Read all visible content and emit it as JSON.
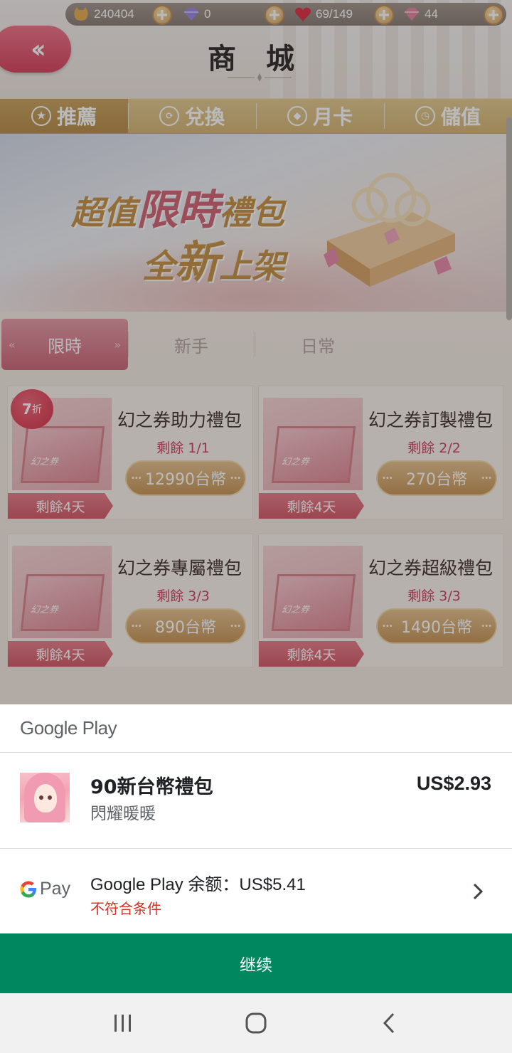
{
  "game": {
    "resources": [
      {
        "icon": "cat-coin-icon",
        "value": "240404"
      },
      {
        "icon": "diamond-icon",
        "value": "0"
      },
      {
        "icon": "heart-stamina-icon",
        "value": "69/149"
      },
      {
        "icon": "pink-diamond-icon",
        "value": "44"
      }
    ],
    "title": "商 城",
    "main_tabs": [
      {
        "label": "推薦",
        "icon": "star-icon",
        "active": true
      },
      {
        "label": "兌換",
        "icon": "exchange-icon",
        "active": false
      },
      {
        "label": "月卡",
        "icon": "diamond-card-icon",
        "active": false
      },
      {
        "label": "儲值",
        "icon": "clock-icon",
        "active": false
      }
    ],
    "banner": {
      "line1_a": "超值",
      "line1_b": "限時",
      "line1_c": "禮包",
      "line2_a": "全",
      "line2_b": "新",
      "line2_c": "上架"
    },
    "sub_tabs": [
      {
        "label": "限時",
        "active": true
      },
      {
        "label": "新手",
        "active": false
      },
      {
        "label": "日常",
        "active": false
      }
    ],
    "cards": [
      {
        "name": "幻之券助力禮包",
        "remain": "剩餘 1/1",
        "price": "12990台幣",
        "days": "剩餘4天",
        "discount": "7",
        "discount_unit": "折",
        "box_label": "幻之券"
      },
      {
        "name": "幻之券訂製禮包",
        "remain": "剩餘 2/2",
        "price": "270台幣",
        "days": "剩餘4天",
        "box_label": "幻之券"
      },
      {
        "name": "幻之券專屬禮包",
        "remain": "剩餘 3/3",
        "price": "890台幣",
        "days": "剩餘4天",
        "box_label": "幻之券"
      },
      {
        "name": "幻之券超級禮包",
        "remain": "剩餘 3/3",
        "price": "1490台幣",
        "days": "剩餘4天",
        "box_label": "幻之券"
      }
    ]
  },
  "sheet": {
    "header": "Google Play",
    "item": {
      "title": "90新台幣禮包",
      "app": "閃耀暖暖",
      "price": "US$2.93"
    },
    "payment": {
      "method": "Pay",
      "balance": "Google Play 余额：US$5.41",
      "warning": "不符合条件"
    },
    "continue_label": "继续",
    "colors": {
      "accent": "#01875f",
      "warning": "#d93025"
    }
  },
  "navbar": {
    "buttons": [
      "recent-apps-icon",
      "home-icon",
      "back-icon"
    ]
  }
}
